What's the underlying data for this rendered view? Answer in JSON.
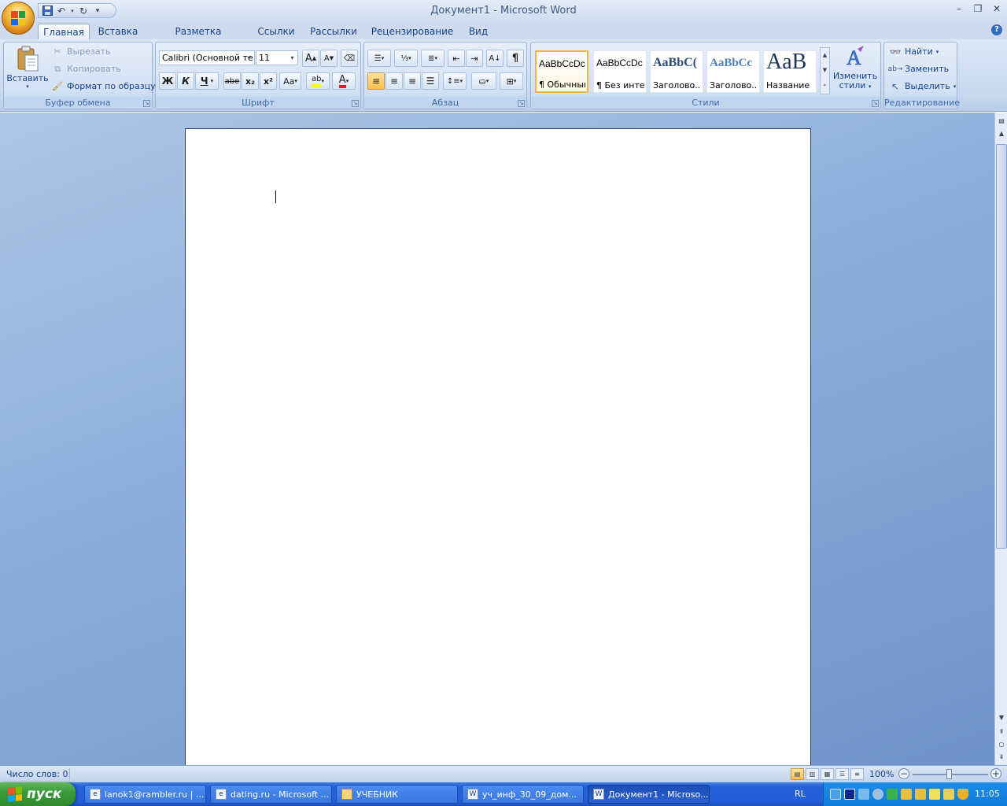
{
  "window": {
    "title": "Документ1 - Microsoft Word"
  },
  "qat": {
    "save_icon": "save-icon",
    "undo_icon": "undo-icon",
    "redo_icon": "redo-icon"
  },
  "tabs": [
    "Главная",
    "Вставка",
    "Разметка страницы",
    "Ссылки",
    "Рассылки",
    "Рецензирование",
    "Вид"
  ],
  "clipboard": {
    "paste": "Вставить",
    "cut": "Вырезать",
    "copy": "Копировать",
    "format_painter": "Формат по образцу",
    "label": "Буфер обмена"
  },
  "font": {
    "name": "Calibri (Основной те",
    "size": "11",
    "label": "Шрифт",
    "bold": "Ж",
    "italic": "К",
    "underline": "Ч",
    "strike": "abe",
    "sub": "x₂",
    "sup": "x²",
    "case": "Aa",
    "grow": "A",
    "shrink": "A",
    "color_letter": "A"
  },
  "paragraph": {
    "label": "Абзац",
    "pilcrow": "¶"
  },
  "styles": {
    "label": "Стили",
    "items": [
      {
        "sample": "AaBbCcDc",
        "name": "¶ Обычный"
      },
      {
        "sample": "AaBbCcDc",
        "name": "¶ Без инте..."
      },
      {
        "sample": "AaBbC(",
        "name": "Заголово..."
      },
      {
        "sample": "AaBbCc",
        "name": "Заголово..."
      },
      {
        "sample": "AaB",
        "name": "Название"
      }
    ],
    "change": "Изменить стили",
    "change_line1": "Изменить",
    "change_line2": "стили"
  },
  "editing": {
    "find": "Найти",
    "replace": "Заменить",
    "select": "Выделить",
    "label": "Редактирование"
  },
  "status": {
    "words": "Число слов: 0",
    "zoom": "100%"
  },
  "taskbar": {
    "start": "пуск",
    "tasks": [
      {
        "label": "lanok1@rambler.ru | ...",
        "icon": "ie"
      },
      {
        "label": "dating.ru - Microsoft ...",
        "icon": "ie"
      },
      {
        "label": "УЧЕБНИК",
        "icon": "folder"
      },
      {
        "label": "уч_инф_30_09_дом...",
        "icon": "word"
      },
      {
        "label": "Документ1 - Microso...",
        "icon": "word"
      }
    ],
    "lang": "RL",
    "clock": "11:05"
  }
}
